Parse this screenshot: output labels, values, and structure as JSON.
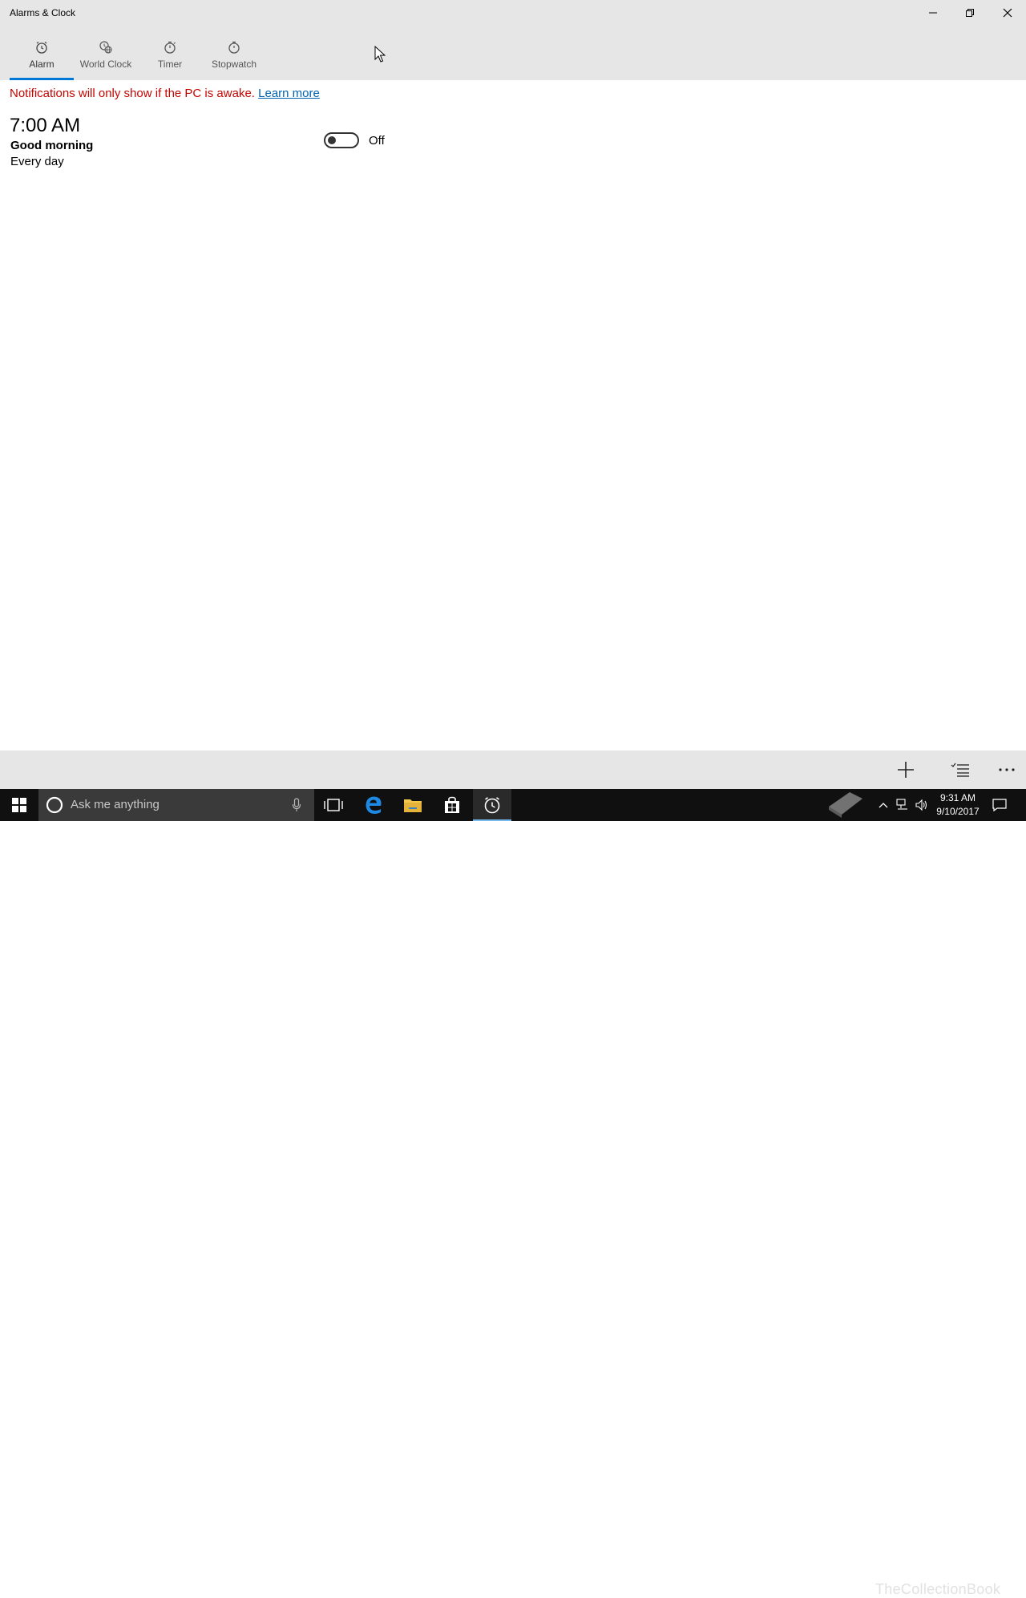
{
  "window": {
    "title": "Alarms & Clock"
  },
  "tabs": [
    {
      "label": "Alarm",
      "active": true
    },
    {
      "label": "World Clock",
      "active": false
    },
    {
      "label": "Timer",
      "active": false
    },
    {
      "label": "Stopwatch",
      "active": false
    }
  ],
  "notice": {
    "text": "Notifications will only show if the PC is awake.",
    "link": "Learn more"
  },
  "alarm": {
    "time": "7:00 AM",
    "name": "Good morning",
    "repeat": "Every day",
    "state": "Off"
  },
  "command_bar": {
    "add_icon": "plus-icon",
    "select_icon": "select-list-icon",
    "more_icon": "more-icon"
  },
  "taskbar": {
    "search_placeholder": "Ask me anything",
    "clock_time": "9:31 AM",
    "clock_date": "9/10/2017",
    "watermark": "TheCollectionBook"
  },
  "colors": {
    "accent": "#0078d7",
    "notice": "#c50500",
    "link": "#0063b1",
    "chrome": "#e6e6e6",
    "taskbar": "#101010"
  }
}
